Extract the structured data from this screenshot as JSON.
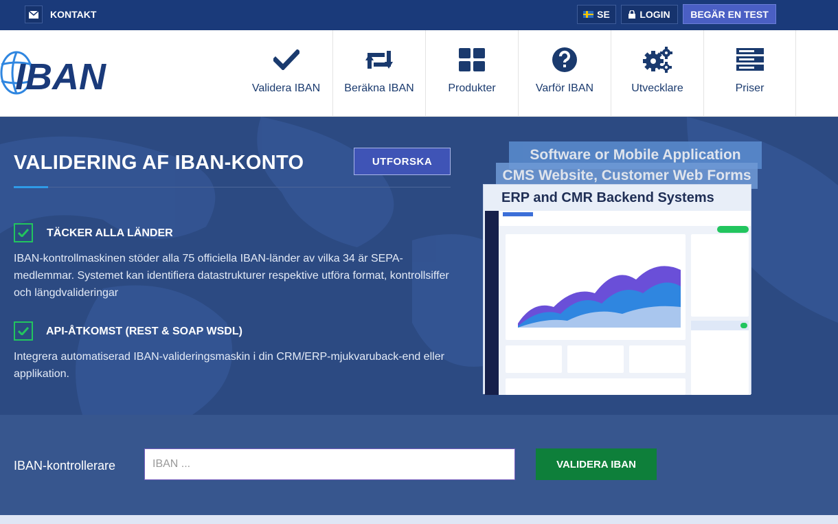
{
  "topbar": {
    "contact_label": "KONTAKT",
    "lang_label": "SE",
    "login_label": "LOGIN",
    "trial_label": "BEGÄR EN TEST"
  },
  "logo": {
    "text": "IBAN"
  },
  "nav": {
    "items": [
      {
        "label": "Validera IBAN",
        "icon": "check-icon"
      },
      {
        "label": "Beräkna IBAN",
        "icon": "retweet-icon"
      },
      {
        "label": "Produkter",
        "icon": "grid-icon"
      },
      {
        "label": "Varför IBAN",
        "icon": "question-circle-icon"
      },
      {
        "label": "Utvecklare",
        "icon": "gears-icon"
      },
      {
        "label": "Priser",
        "icon": "server-icon"
      }
    ]
  },
  "hero": {
    "title": "VALIDERING AF IBAN-KONTO",
    "explore_label": "UTFORSKA",
    "features": [
      {
        "title": "TÄCKER ALLA LÄNDER",
        "text": "IBAN-kontrollmaskinen stöder alla 75 officiella IBAN-länder av vilka 34 är SEPA-medlemmar. Systemet kan identifiera datastrukturer respektive utföra format, kontrollsiffer och längdvalideringar"
      },
      {
        "title": "API-ÅTKOMST (REST & SOAP WSDL)",
        "text": "Integrera automatiserad IBAN-valideringsmaskin i din CRM/ERP-mjukvaruback-end eller applikation."
      }
    ],
    "mockup": {
      "layer1": "Software or Mobile Application",
      "layer2": "CMS Website, Customer Web Forms",
      "layer3": "ERP and CMR Backend Systems"
    }
  },
  "validator": {
    "label": "IBAN-kontrollerare",
    "placeholder": "IBAN ...",
    "value": "",
    "button_label": "VALIDERA IBAN"
  },
  "colors": {
    "topbar": "#1a3a7a",
    "hero": "#2c4a82",
    "accent_button": "#4a5fc4",
    "validate_button": "#0e7f3a",
    "check_green": "#22c55e",
    "nav_text": "#1a3a6e"
  }
}
